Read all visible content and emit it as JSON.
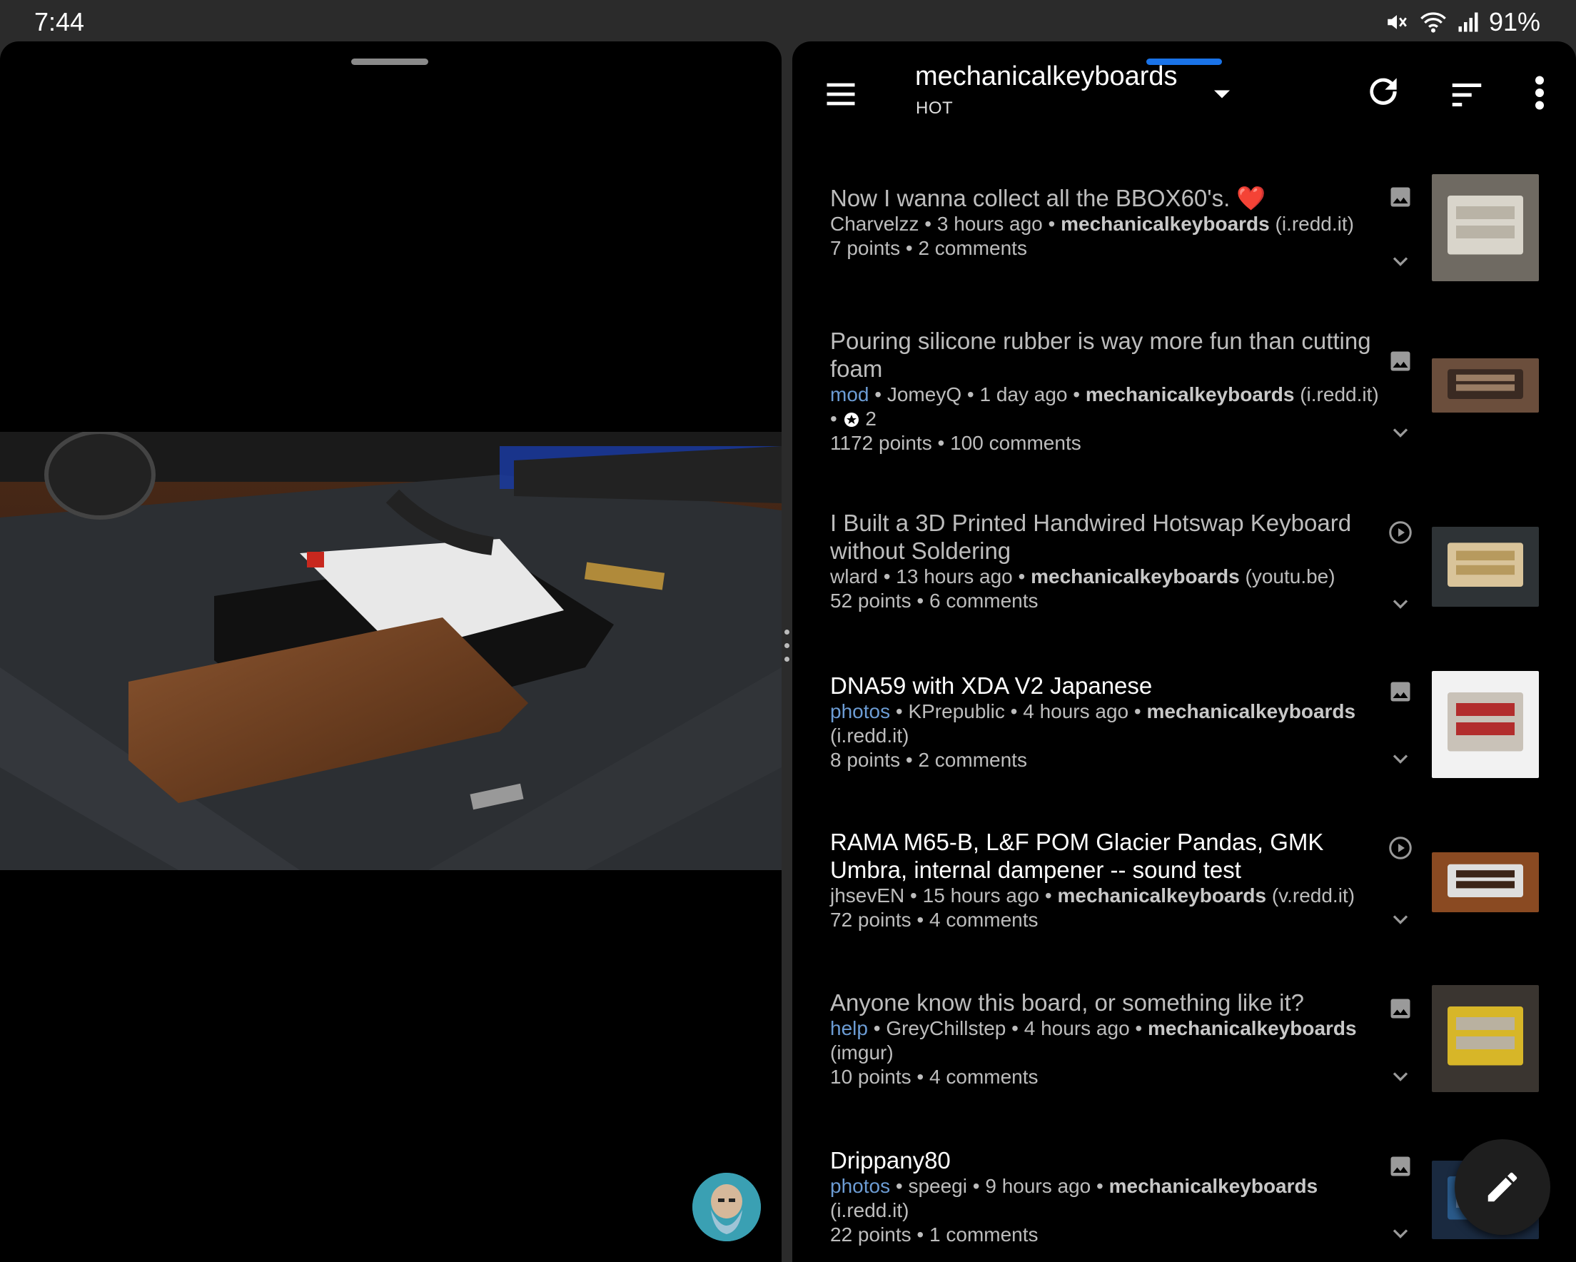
{
  "status_bar": {
    "time": "7:44",
    "battery": "91%"
  },
  "header": {
    "subreddit": "mechanicalkeyboards",
    "sort": "HOT"
  },
  "posts": [
    {
      "title": "Now I wanna collect all the BBOX60's. ❤️",
      "flair": "",
      "author": "Charvelzz",
      "age": "3 hours ago",
      "subreddit": "mechanicalkeyboards",
      "domain": "(i.redd.it)",
      "awards": "",
      "points": "7 points",
      "comments": "2 comments",
      "type": "image",
      "read": true
    },
    {
      "title": "Pouring silicone rubber is way more fun than cutting foam",
      "flair": "mod",
      "author": "JomeyQ",
      "age": "1 day ago",
      "subreddit": "mechanicalkeyboards",
      "domain": "(i.redd.it)",
      "awards": "2",
      "points": "1172 points",
      "comments": "100 comments",
      "type": "image",
      "read": true
    },
    {
      "title": "I Built a 3D Printed Handwired Hotswap Keyboard without Soldering",
      "flair": "",
      "author": "wlard",
      "age": "13 hours ago",
      "subreddit": "mechanicalkeyboards",
      "domain": "(youtu.be)",
      "awards": "",
      "points": "52 points",
      "comments": "6 comments",
      "type": "video",
      "read": true
    },
    {
      "title": "DNA59 with XDA V2 Japanese",
      "flair": "photos",
      "author": "KPrepublic",
      "age": "4 hours ago",
      "subreddit": "mechanicalkeyboards",
      "domain": "(i.redd.it)",
      "awards": "",
      "points": "8 points",
      "comments": "2 comments",
      "type": "image",
      "read": false
    },
    {
      "title": "RAMA M65-B, L&F POM Glacier Pandas, GMK Umbra, internal dampener -- sound test",
      "flair": "",
      "author": "jhsevEN",
      "age": "15 hours ago",
      "subreddit": "mechanicalkeyboards",
      "domain": "(v.redd.it)",
      "awards": "",
      "points": "72 points",
      "comments": "4 comments",
      "type": "video",
      "read": false
    },
    {
      "title": "Anyone know this board, or something like it?",
      "flair": "help",
      "author": "GreyChillstep",
      "age": "4 hours ago",
      "subreddit": "mechanicalkeyboards",
      "domain": "(imgur)",
      "awards": "",
      "points": "10 points",
      "comments": "4 comments",
      "type": "image",
      "read": true
    },
    {
      "title": "Drippany80",
      "flair": "photos",
      "author": "speegi",
      "age": "9 hours ago",
      "subreddit": "mechanicalkeyboards",
      "domain": "(i.redd.it)",
      "awards": "",
      "points": "22 points",
      "comments": "1 comments",
      "type": "image",
      "read": false
    }
  ],
  "separator": " • "
}
